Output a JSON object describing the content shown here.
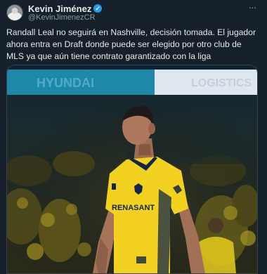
{
  "tweet": {
    "author_name": "Kevin Jiménez",
    "author_handle": "@KevinJimenezCR",
    "verified_icon": "verified-badge-icon",
    "more_icon": "more-options-icon",
    "text": "Randall Leal no seguirá en Nashville, decisión tomada. El jugador ahora entra en Draft donde puede ser elegido por otro club de MLS ya que aún tiene contrato garantizado con la liga"
  },
  "photo": {
    "banner_left_text": "HYUNDAI",
    "banner_right_text": "LOGISTICS",
    "jersey_sponsor": "RENASANT",
    "colors": {
      "jersey": "#f2d21f",
      "jersey_trim": "#11264a",
      "banner_left": "#1e88a8",
      "banner_right": "#e9eef2",
      "crowd": "#c7b51e"
    }
  }
}
